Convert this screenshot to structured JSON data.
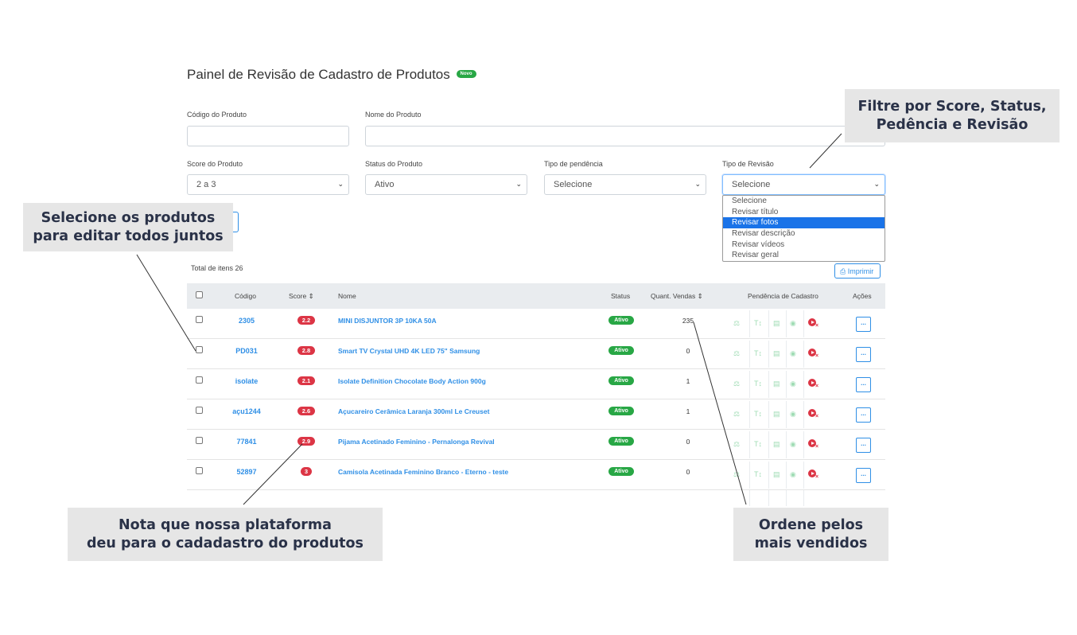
{
  "page": {
    "title": "Painel de Revisão de Cadastro de Produtos",
    "new_badge": "Novo"
  },
  "filters": {
    "code_label": "Código do Produto",
    "code_value": "",
    "name_label": "Nome do Produto",
    "name_value": "",
    "score_label": "Score do Produto",
    "score_value": "2 a 3",
    "status_label": "Status do Produto",
    "status_value": "Ativo",
    "pending_label": "Tipo de pendência",
    "pending_value": "Selecione",
    "review_label": "Tipo de Revisão",
    "review_value": "Selecione",
    "review_options": [
      "Selecione",
      "Revisar título",
      "Revisar fotos",
      "Revisar descrição",
      "Revisar vídeos",
      "Revisar geral"
    ],
    "review_highlighted": "Revisar fotos"
  },
  "summary": {
    "total_label": "Total de itens 26",
    "print_label": "Imprimir"
  },
  "table": {
    "headers": {
      "code": "Código",
      "score": "Score",
      "name": "Nome",
      "status": "Status",
      "sales": "Quant. Vendas",
      "pending": "Pendência de Cadastro",
      "actions": "Ações"
    },
    "rows": [
      {
        "code": "2305",
        "score": "2.2",
        "name": "MINI DISJUNTOR 3P 10KA 50A",
        "status": "Ativo",
        "sales": "235",
        "action": "..."
      },
      {
        "code": "PD031",
        "score": "2.8",
        "name": "Smart TV Crystal UHD 4K LED 75\" Samsung",
        "status": "Ativo",
        "sales": "0",
        "action": "..."
      },
      {
        "code": "isolate",
        "score": "2.1",
        "name": "Isolate Definition Chocolate Body Action 900g",
        "status": "Ativo",
        "sales": "1",
        "action": "..."
      },
      {
        "code": "açu1244",
        "score": "2.6",
        "name": "Açucareiro Cerâmica Laranja 300ml Le Creuset",
        "status": "Ativo",
        "sales": "1",
        "action": "..."
      },
      {
        "code": "77841",
        "score": "2.9",
        "name": "Pijama Acetinado Feminino - Pernalonga Revival",
        "status": "Ativo",
        "sales": "0",
        "action": "..."
      },
      {
        "code": "52897",
        "score": "3",
        "name": "Camisola Acetinada Feminino Branco - Eterno - teste",
        "status": "Ativo",
        "sales": "0",
        "action": "..."
      }
    ],
    "pending_icons": [
      "balance-icon",
      "text-size-icon",
      "document-icon",
      "camera-icon",
      "video-missing-icon"
    ]
  },
  "callouts": {
    "filter": [
      "Filtre por Score, Status,",
      "Pedência e Revisão"
    ],
    "select": [
      "Selecione os produtos",
      "para editar todos juntos"
    ],
    "score": [
      "Nota que nossa plataforma",
      "deu para o cadadastro do produtos"
    ],
    "sales": [
      "Ordene pelos",
      "mais vendidos"
    ]
  },
  "colors": {
    "accent": "#2f8fe6",
    "success": "#28a745",
    "danger": "#dc3545",
    "callout_bg": "#e6e6e6",
    "callout_text": "#2a3248"
  }
}
